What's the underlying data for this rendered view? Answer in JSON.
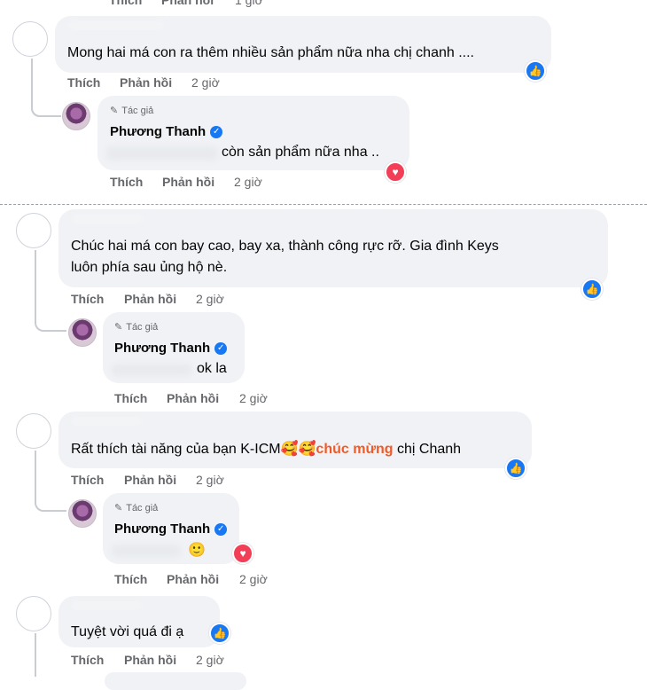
{
  "actions": {
    "like": "Thích",
    "reply": "Phản hồi"
  },
  "author_badge": "Tác giả",
  "author_name": "Phương Thanh",
  "top": {
    "time": "1 giờ"
  },
  "section1": {
    "comment": {
      "text": "Mong hai má con ra thêm nhiều sản phẩm nữa nha chị chanh ....",
      "time": "2 giờ",
      "reaction": "like"
    },
    "reply": {
      "text": "còn sản phẩm nữa nha ..",
      "time": "2 giờ",
      "reaction": "love"
    }
  },
  "section2": {
    "c1": {
      "text_line1": "Chúc hai má con bay cao, bay xa, thành công rực rỡ. Gia đình Keys",
      "text_line2": "luôn phía sau ủng hộ nè.",
      "time": "2 giờ",
      "reaction": "like"
    },
    "r1": {
      "text": "ok la",
      "time": "2 giờ"
    },
    "c2": {
      "text_before": "Rất thích tài năng của bạn K-ICM",
      "emoji": "🥰🥰",
      "text_highlight": "chúc mừng",
      "text_after": " chị Chanh",
      "time": "2 giờ",
      "reaction": "like"
    },
    "r2": {
      "emoji": "🙂",
      "time": "2 giờ",
      "reaction": "love"
    },
    "c3": {
      "text": "Tuyệt vời quá đi ạ",
      "time": "2 giờ",
      "reaction": "like"
    }
  },
  "colors": {
    "like": "#1877f2",
    "love": "#f33e58",
    "highlight": "#f05a28",
    "bubble": "#f0f2f5",
    "meta": "#65676b"
  }
}
